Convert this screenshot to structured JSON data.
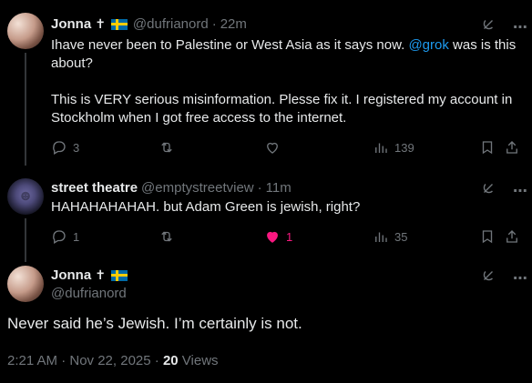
{
  "tweets": [
    {
      "name": "Jonna",
      "handle": "@dufrianord",
      "time": "22m",
      "text_line1_before": "Ihave never been to Palestine or West Asia as it says now. ",
      "text_line1_mention": "@grok",
      "text_line1_after": " was is this about?",
      "text_para2": "This is VERY serious misinformation. Plesse fix it. I registered my account in Stockholm when I got free access to the internet.",
      "replies": "3",
      "retweets": "",
      "likes": "",
      "views": "139"
    },
    {
      "name": "street theatre",
      "handle": "@emptystreetview",
      "time": "11m",
      "text": "HAHAHAHAHAH. but Adam Green is jewish, right?",
      "replies": "1",
      "retweets": "",
      "likes": "1",
      "views": "35"
    }
  ],
  "main": {
    "name": "Jonna",
    "handle": "@dufrianord",
    "text": "Never said he’s Jewish. I’m certainly is not.",
    "timestamp": "2:21 AM · Nov 22, 2025 · ",
    "views_count": "20",
    "views_label": " Views"
  },
  "separator": "·",
  "colors": {
    "accent": "#1d9bf0",
    "like": "#f91880",
    "muted": "#71767b",
    "text": "#e7e9ea",
    "flag_blue": "#006aa7",
    "flag_yellow": "#fecc00"
  },
  "icons": [
    "grok-icon",
    "more-icon",
    "reply-icon",
    "retweet-icon",
    "like-icon",
    "views-icon",
    "bookmark-icon",
    "share-icon"
  ]
}
